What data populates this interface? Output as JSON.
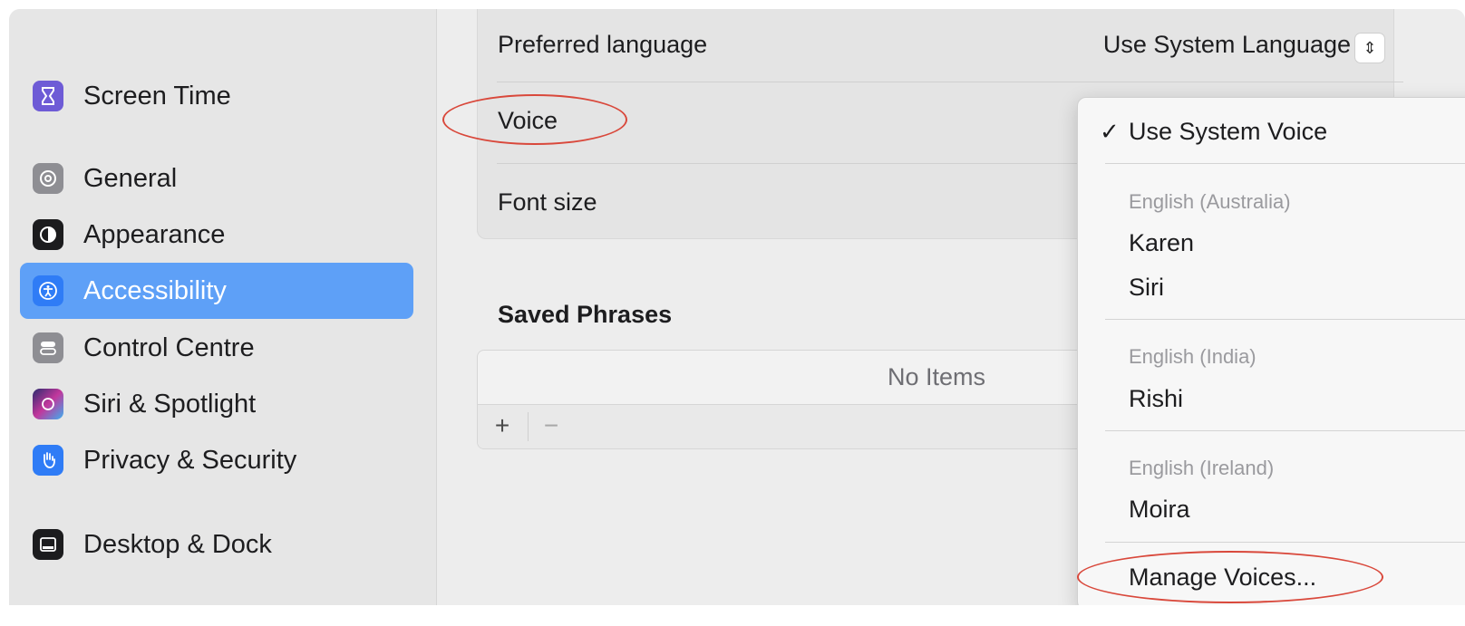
{
  "sidebar": {
    "items": [
      {
        "label": "Screen Time",
        "icon": "hourglass-icon",
        "color": "#6e5bd6"
      },
      {
        "label": "General",
        "icon": "gear-icon",
        "color": "#8e8e93"
      },
      {
        "label": "Appearance",
        "icon": "appearance-icon",
        "color": "#1c1c1e"
      },
      {
        "label": "Accessibility",
        "icon": "accessibility-icon",
        "color": "#2f7cf6",
        "selected": true
      },
      {
        "label": "Control Centre",
        "icon": "toggles-icon",
        "color": "#8e8e93"
      },
      {
        "label": "Siri & Spotlight",
        "icon": "siri-icon",
        "color": "#3b3b7a"
      },
      {
        "label": "Privacy & Security",
        "icon": "hand-icon",
        "color": "#2f7cf6"
      },
      {
        "label": "Desktop & Dock",
        "icon": "dock-icon",
        "color": "#1c1c1e"
      }
    ]
  },
  "settings": {
    "preferred_language_label": "Preferred language",
    "preferred_language_value": "Use System Language",
    "voice_label": "Voice",
    "font_size_label": "Font size"
  },
  "saved_phrases": {
    "title": "Saved Phrases",
    "empty_text": "No Items",
    "add_label": "+",
    "remove_label": "−"
  },
  "voice_menu": {
    "selected_mark": "✓",
    "system_voice": "Use System Voice",
    "groups": [
      {
        "header": "English (Australia)",
        "voices": [
          "Karen",
          "Siri"
        ]
      },
      {
        "header": "English (India)",
        "voices": [
          "Rishi"
        ]
      },
      {
        "header": "English (Ireland)",
        "voices": [
          "Moira"
        ]
      }
    ],
    "manage": "Manage Voices..."
  },
  "colors": {
    "selection": "#5ea0f7",
    "annotation": "#d9483b"
  }
}
